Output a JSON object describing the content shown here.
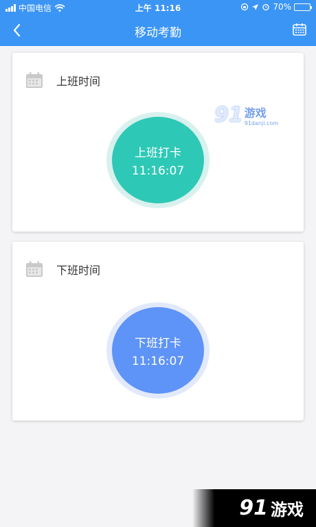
{
  "status_bar": {
    "carrier": "中国电信",
    "time": "上午 11:16",
    "battery_percent": "70%",
    "battery_level": 0.7
  },
  "nav": {
    "title": "移动考勤",
    "back_icon": "chevron-left-icon",
    "calendar_icon": "calendar-icon"
  },
  "checkin": {
    "section_title": "上班时间",
    "button_label": "上班打卡",
    "time": "11:16:07"
  },
  "checkout": {
    "section_title": "下班时间",
    "button_label": "下班打卡",
    "time": "11:16:07"
  },
  "watermark": {
    "number": "91",
    "name": "游戏",
    "domain": "91danji.com"
  },
  "colors": {
    "header": "#3b95f5",
    "checkin": "#2ec8b6",
    "checkout": "#5e93f7",
    "background": "#f4f4f6"
  }
}
